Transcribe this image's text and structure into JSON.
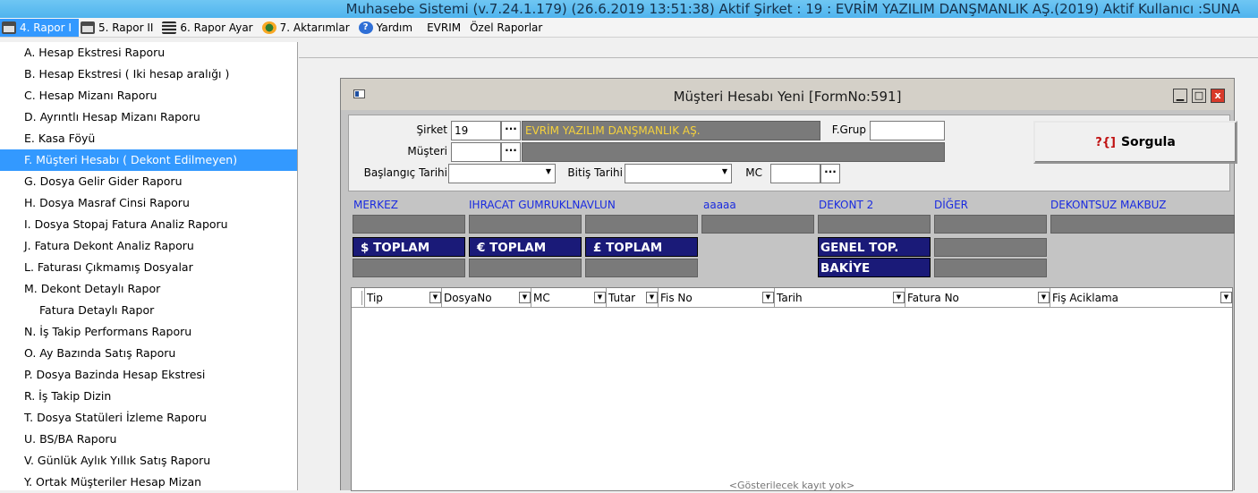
{
  "titlebar": "Muhasebe Sistemi (v.7.24.1.179) (26.6.2019 13:51:38) Aktif Şirket : 19 : EVRİM YAZILIM DANŞMANLIK AŞ.(2019) Aktif Kullanıcı :SUNA",
  "menu": [
    {
      "label": "4. Rapor I",
      "icon": "printer-icon"
    },
    {
      "label": "5. Rapor II",
      "icon": "printer-icon"
    },
    {
      "label": "6. Rapor Ayar",
      "icon": "settings-icon"
    },
    {
      "label": "7. Aktarımlar",
      "icon": "transfer-icon"
    },
    {
      "label": "Yardım",
      "icon": "help-icon"
    },
    {
      "label": "EVRIM"
    },
    {
      "label": "Özel Raporlar"
    }
  ],
  "sidebar": [
    "A.  Hesap Ekstresi Raporu",
    "B.  Hesap Ekstresi ( Iki hesap aralığı )",
    "C.  Hesap Mizanı Raporu",
    "D.  Ayrıntlı Hesap Mizanı Raporu",
    "E.  Kasa Föyü",
    "F.  Müşteri Hesabı ( Dekont Edilmeyen)",
    "G.  Dosya Gelir Gider Raporu",
    "H.  Dosya Masraf Cinsi Raporu",
    "I.  Dosya Stopaj Fatura Analiz Raporu",
    "J.  Fatura Dekont Analiz Raporu",
    "L.  Faturası Çıkmamış Dosyalar",
    "M.  Dekont Detaylı Rapor",
    "Fatura Detaylı Rapor",
    "N.  İş Takip Performans Raporu",
    "O.  Ay Bazında Satış Raporu",
    "P.  Dosya Bazinda Hesap Ekstresi",
    "R.  İş Takip Dizin",
    "T.  Dosya Statüleri İzleme Raporu",
    "U.  BS/BA Raporu",
    "V.  Günlük Aylık Yıllık Satış Raporu",
    "Y.  Ortak Müşteriler Hesap Mizan"
  ],
  "sidebar_selected_index": 5,
  "window": {
    "title": "Müşteri Hesabı Yeni [FormNo:591]",
    "btn_min": "▁",
    "btn_max": "□",
    "btn_close": "x"
  },
  "form": {
    "sirket_label": "Şirket",
    "sirket_value": "19",
    "sirket_name": "EVRİM YAZILIM DANŞMANLIK AŞ.",
    "dots": "···",
    "fgrup_label": "F.Grup",
    "musteri_label": "Müşteri",
    "baslangic_label": "Başlangıç Tarihi",
    "bitis_label": "Bitiş Tarihi",
    "mc_label": "MC",
    "sorgula_label": "Sorgula",
    "sorgula_icon": "?{]"
  },
  "summary": {
    "headers": [
      "MERKEZ",
      "IHRACAT GUMRUKLNAVLUN",
      "aaaaa",
      "DEKONT 2",
      "DİĞER",
      "DEKONTSUZ MAKBUZ"
    ],
    "totals": [
      "$ TOPLAM",
      "€ TOPLAM",
      "£ TOPLAM",
      "GENEL TOP.",
      "BAKİYE"
    ]
  },
  "grid": {
    "columns": [
      "Tip",
      "DosyaNo",
      "MC",
      "Tutar",
      "Fis No",
      "Tarih",
      "Fatura No",
      "Fiş Aciklama"
    ],
    "empty_text": "<Gösterilecek kayıt yok>"
  }
}
